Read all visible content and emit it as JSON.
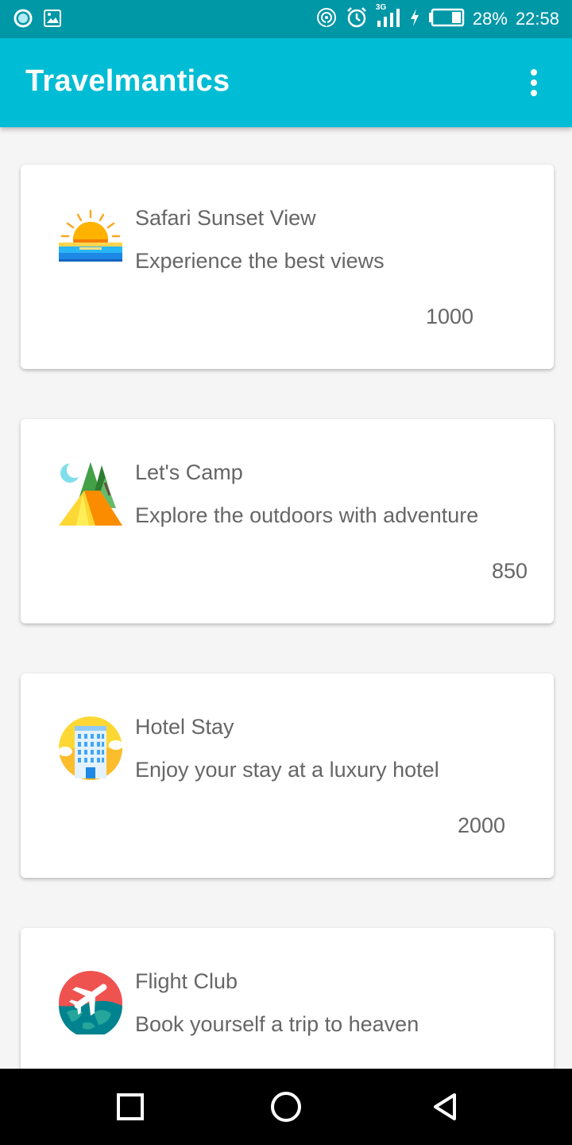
{
  "status_bar": {
    "battery_percent": "28%",
    "time": "22:58",
    "network": "3G",
    "icons": [
      "record-icon",
      "image-icon",
      "hotspot-icon",
      "alarm-icon",
      "signal-icon",
      "charging-icon",
      "battery-icon"
    ]
  },
  "app_bar": {
    "title": "Travelmantics",
    "menu_icon": "more-vert-icon"
  },
  "deals": [
    {
      "title": "Safari Sunset View",
      "description": "Experience the best views",
      "price": "1000",
      "icon": "sunset-icon"
    },
    {
      "title": "Let's Camp",
      "description": "Explore the outdoors with adventure",
      "price": "850",
      "icon": "tent-icon"
    },
    {
      "title": "Hotel Stay",
      "description": "Enjoy your stay at a luxury hotel",
      "price": "2000",
      "icon": "hotel-icon"
    },
    {
      "title": "Flight Club",
      "description": "Book yourself a trip to heaven",
      "price": "",
      "icon": "plane-globe-icon"
    }
  ],
  "nav_bar": {
    "icons": [
      "recent-apps-icon",
      "home-icon",
      "back-icon"
    ]
  },
  "colors": {
    "status_bar": "#0097a7",
    "app_bar": "#00bcd4",
    "background": "#f5f5f5",
    "card": "#ffffff",
    "text_secondary": "#666666"
  }
}
